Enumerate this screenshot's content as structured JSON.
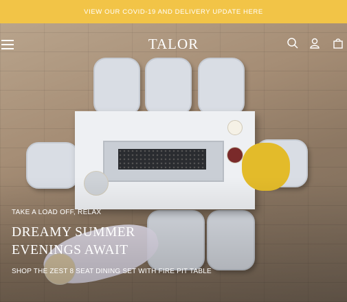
{
  "banner": {
    "text": "VIEW OUR COVID-19 AND DELIVERY UPDATE HERE",
    "color": "#f2c447"
  },
  "header": {
    "logo": "TALOR",
    "icons": [
      "menu-icon",
      "search-icon",
      "account-icon",
      "cart-icon"
    ]
  },
  "hero": {
    "eyebrow": "TAKE A LOAD OFF, RELAX",
    "headline_line1": "DREAMY SUMMER",
    "headline_line2": "EVENINGS AWAIT",
    "cta": "SHOP THE ZEST 8 SEAT DINING SET WITH FIRE PIT TABLE"
  }
}
